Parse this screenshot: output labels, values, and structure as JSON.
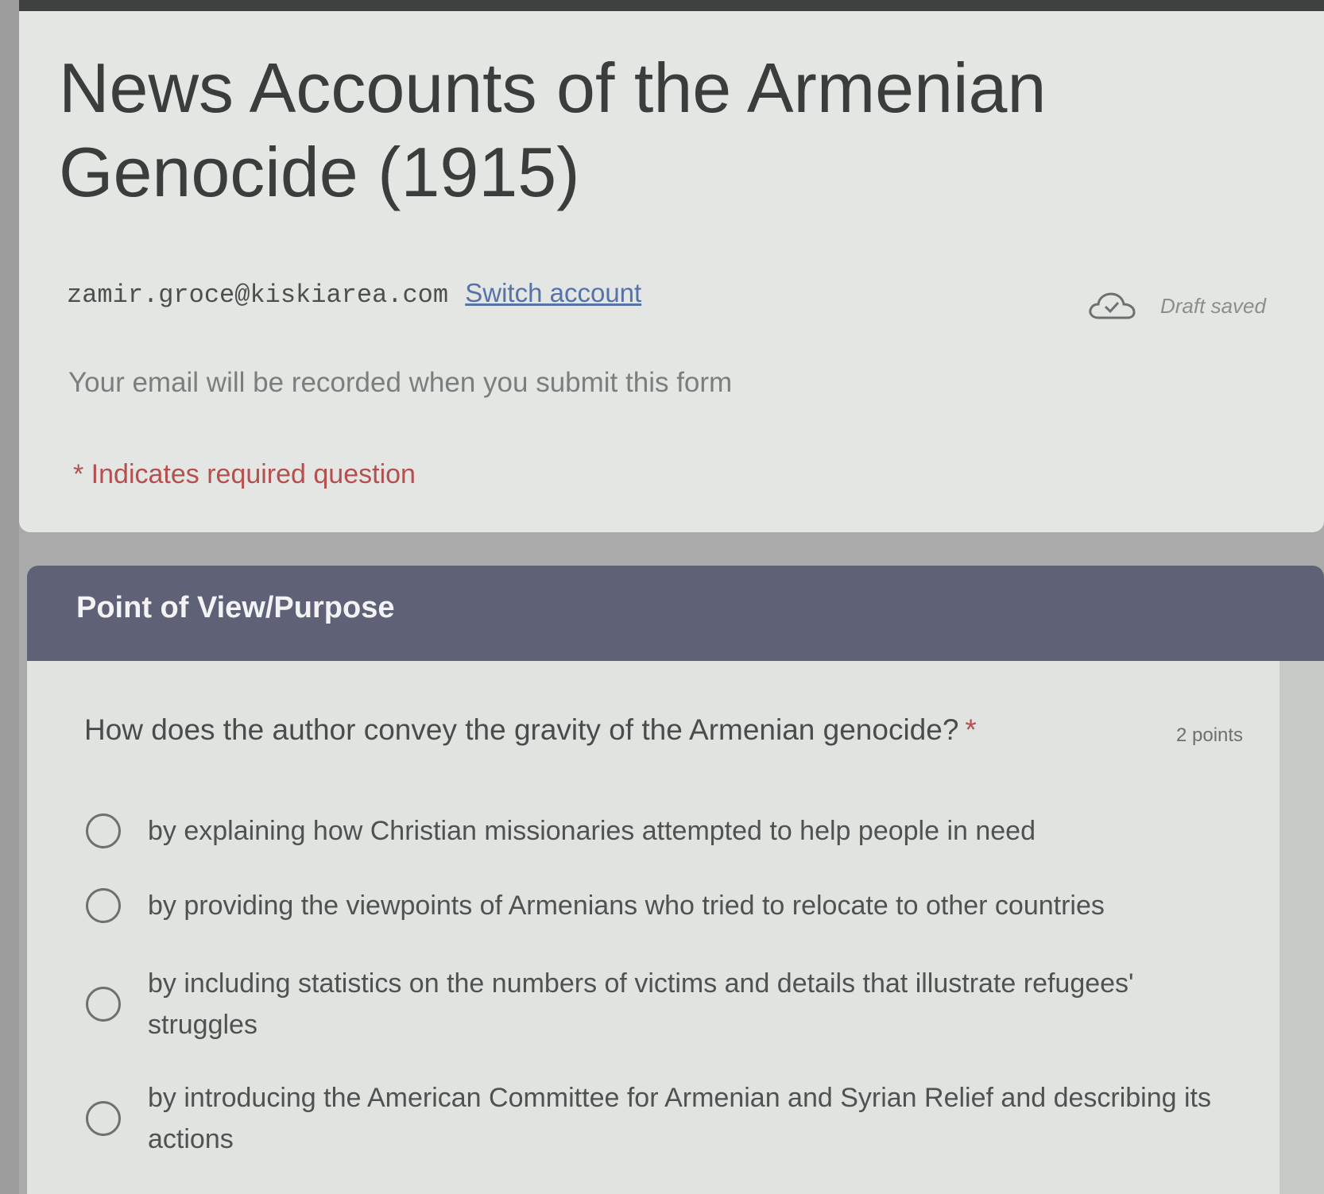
{
  "form": {
    "title": "News Accounts of the Armenian Genocide (1915)",
    "account_email": "zamir.groce@kiskiarea.com",
    "switch_account_label": "Switch account",
    "draft_status": "Draft saved",
    "email_notice": "Your email will be recorded when you submit this form",
    "required_note": "* Indicates required question"
  },
  "section": {
    "title": "Point of View/Purpose"
  },
  "question": {
    "text": "How does the author convey the gravity of the Armenian genocide?",
    "required_marker": "*",
    "points": "2 points",
    "options": [
      {
        "label": "by explaining how Christian missionaries attempted to help people in need"
      },
      {
        "label": "by providing the viewpoints of Armenians who tried to relocate to other countries"
      },
      {
        "label": "by including statistics on the numbers of victims and details that illustrate refugees' struggles"
      },
      {
        "label": "by introducing the American Committee for Armenian and Syrian Relief and describing its actions"
      }
    ]
  },
  "icons": {
    "draft": "cloud-check-icon"
  },
  "colors": {
    "section_header": "#5f6276",
    "required": "#b4504f",
    "link": "#5573a8"
  }
}
